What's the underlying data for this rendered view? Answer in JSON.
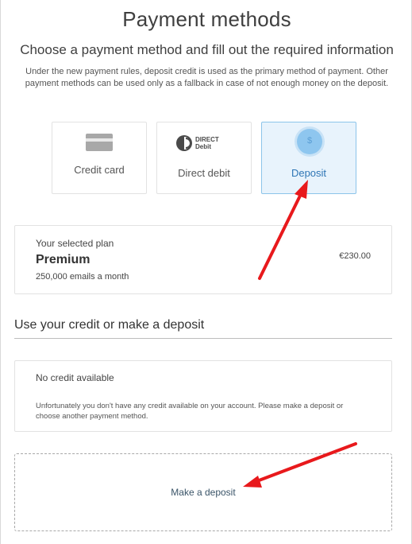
{
  "header": {
    "title": "Payment methods",
    "subtitle": "Choose a payment method and fill out the required information",
    "notice": "Under the new payment rules, deposit credit is used as the primary method of payment. Other payment methods can be used only as a fallback in case of not enough money on the deposit."
  },
  "methods": [
    {
      "label": "Credit card",
      "icon": "credit-card-icon",
      "selected": false
    },
    {
      "label": "Direct debit",
      "icon": "direct-debit-logo",
      "logo_text_1": "DIRECT",
      "logo_text_2": "Debit",
      "selected": false
    },
    {
      "label": "Deposit",
      "icon": "dollar-coin-icon",
      "icon_text": "$",
      "selected": true
    }
  ],
  "plan": {
    "caption": "Your selected plan",
    "name": "Premium",
    "description": "250,000 emails a month",
    "price": "€230.00"
  },
  "credit_section": {
    "title": "Use your credit or make a deposit",
    "status_heading": "No credit available",
    "status_text": "Unfortunately you don't have any credit available on your account. Please make a deposit or choose another payment method."
  },
  "deposit": {
    "link_label": "Make a deposit"
  },
  "colors": {
    "selected_bg": "#e8f3fc",
    "selected_border": "#8cc4ea",
    "selected_text": "#2f76b5",
    "annotation_arrow": "#e8191c"
  }
}
